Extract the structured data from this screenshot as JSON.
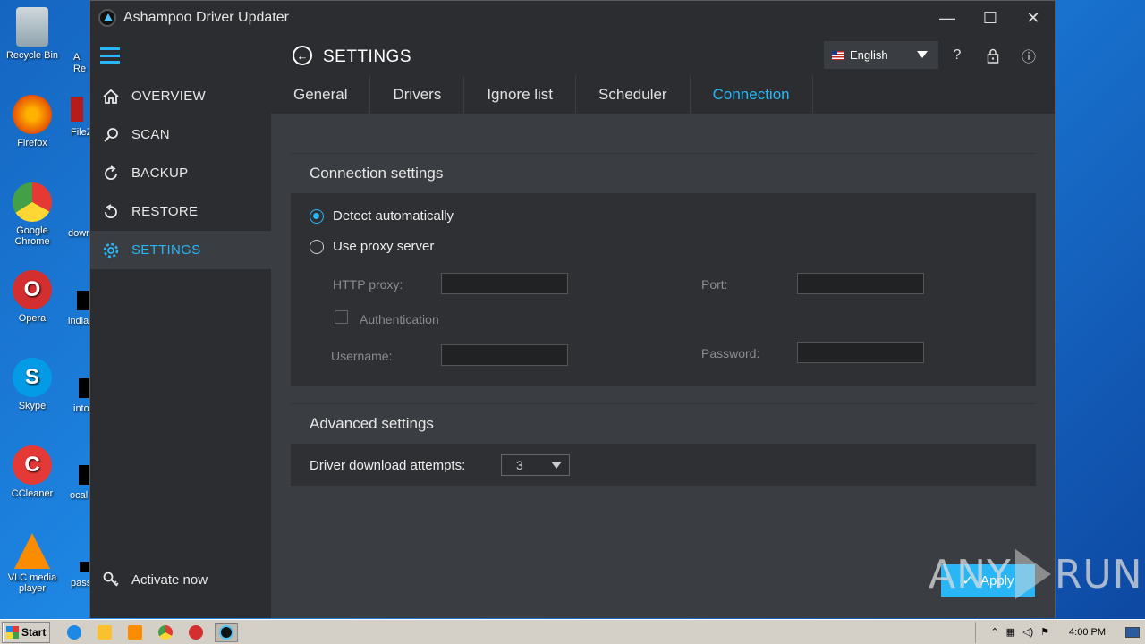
{
  "desktop": {
    "icons": [
      {
        "label": "Recycle Bin"
      },
      {
        "label": "Firefox"
      },
      {
        "label": "Google Chrome"
      },
      {
        "label": "Opera"
      },
      {
        "label": "Skype"
      },
      {
        "label": "CCleaner"
      },
      {
        "label": "VLC media player"
      }
    ],
    "partial_icons": [
      {
        "label": "A\nRe"
      },
      {
        "label": "FileZ"
      },
      {
        "label": "dowr"
      },
      {
        "label": "india"
      },
      {
        "label": "into"
      },
      {
        "label": "ocal"
      },
      {
        "label": "pass"
      }
    ]
  },
  "window": {
    "title": "Ashampoo Driver Updater",
    "controls": {
      "minimize": "—",
      "maximize": "☐",
      "close": "✕"
    }
  },
  "sidebar": {
    "items": [
      {
        "label": "OVERVIEW",
        "icon": "home-icon"
      },
      {
        "label": "SCAN",
        "icon": "search-icon"
      },
      {
        "label": "BACKUP",
        "icon": "backup-icon"
      },
      {
        "label": "RESTORE",
        "icon": "restore-icon"
      },
      {
        "label": "SETTINGS",
        "icon": "gear-icon",
        "active": true
      }
    ],
    "activate_label": "Activate now"
  },
  "header": {
    "title": "SETTINGS",
    "language": "English",
    "help": "?",
    "info": "ⓘ"
  },
  "tabs": [
    {
      "label": "General"
    },
    {
      "label": "Drivers"
    },
    {
      "label": "Ignore list"
    },
    {
      "label": "Scheduler"
    },
    {
      "label": "Connection",
      "active": true
    }
  ],
  "connection": {
    "heading": "Connection settings",
    "detect_label": "Detect automatically",
    "proxy_label": "Use proxy server",
    "http_proxy_label": "HTTP proxy:",
    "http_proxy_value": "",
    "port_label": "Port:",
    "port_value": "",
    "auth_label": "Authentication",
    "username_label": "Username:",
    "username_value": "",
    "password_label": "Password:",
    "password_value": "",
    "selected": "detect"
  },
  "advanced": {
    "heading": "Advanced settings",
    "attempts_label": "Driver download attempts:",
    "attempts_value": "3"
  },
  "apply_label": "Apply",
  "watermark": {
    "left": "ANY",
    "right": "RUN"
  },
  "taskbar": {
    "start_label": "Start",
    "clock": "4:00 PM"
  },
  "colors": {
    "accent": "#29b6f6",
    "sidebar_bg": "#2b2d30",
    "content_bg": "#3a3d41"
  }
}
